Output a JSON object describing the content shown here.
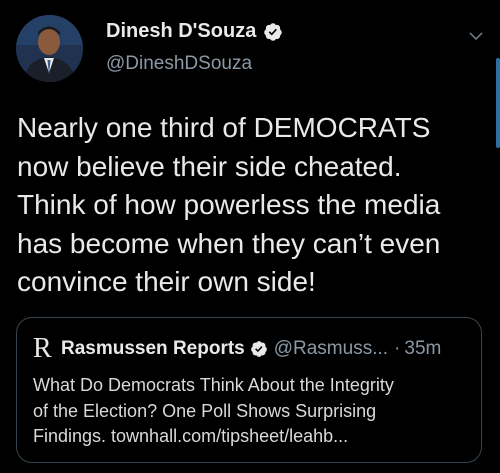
{
  "author": {
    "name": "Dinesh D'Souza",
    "handle": "@DineshDSouza"
  },
  "tweet": {
    "text": "Nearly one third of DEMOCRATS\nnow believe their side cheated.\nThink of how powerless the media\nhas become when they can’t even\nconvince their own side!"
  },
  "quoted": {
    "logo_letter": "R",
    "name": "Rasmussen Reports",
    "handle": "@Rasmuss...",
    "separator": "·",
    "time": "35m",
    "text": "What Do Democrats Think About the Integrity\nof the Election? One Poll Shows Surprising\nFindings. townhall.com/tipsheet/leahb..."
  },
  "colors": {
    "background": "#000000",
    "verified_badge": "#e7e9ea",
    "border": "#38444d",
    "secondary_text": "#8b98a5"
  },
  "icons": {
    "verified": "verified-badge-icon",
    "chevron": "chevron-down-icon"
  }
}
